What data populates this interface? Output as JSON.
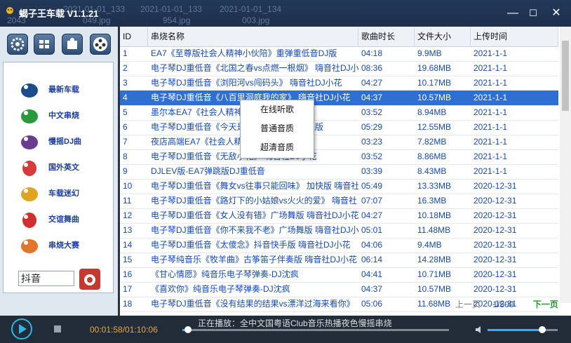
{
  "window": {
    "title": "蝎子王车载 V1.1.21",
    "ghost_files": [
      "2021-01-01_133",
      "2021-01-01_133",
      "2021-01-01_134"
    ],
    "ghost_sub": [
      "2043",
      "049.jpg",
      "954.jpg",
      "003.jpg"
    ],
    "minimize": "—",
    "maximize": "☐",
    "close": "✕"
  },
  "toolbar": [
    "gear-icon",
    "window-icon",
    "puzzle-icon",
    "film-reel-icon"
  ],
  "categories": [
    {
      "label": "最新车载",
      "color": "#1d4c8c"
    },
    {
      "label": "中文串烧",
      "color": "#2c9a3c"
    },
    {
      "label": "慢摇DJ曲",
      "color": "#6a3c8f"
    },
    {
      "label": "国外英文",
      "color": "#d63a3a"
    },
    {
      "label": "车载迷幻",
      "color": "#e0a420"
    },
    {
      "label": "交谊舞曲",
      "color": "#d12f2f"
    },
    {
      "label": "串烧大赛",
      "color": "#e0762a"
    }
  ],
  "search": {
    "value": "抖音"
  },
  "table": {
    "headers": [
      "ID",
      "串烧名称",
      "歌曲时长",
      "文件大小",
      "上传时间"
    ],
    "rows": [
      [
        "1",
        "EA7《至尊版社会人精神小伙陪》重弹重低音DJ版",
        "04:18",
        "9.9MB",
        "2021-1-1"
      ],
      [
        "2",
        "电子琴DJ重低音《北国之春vs点燃一根烟》 嗨音社DJ小花",
        "08:36",
        "19.68MB",
        "2021-1-1"
      ],
      [
        "3",
        "电子琴DJ重低音《浏阳河vs闯码头》 嗨音社DJ小花",
        "04:27",
        "10.17MB",
        "2021-1-1"
      ],
      [
        "4",
        "电子琴DJ重低音《八百里洞庭我的家》 嗨音社DJ小花",
        "04:37",
        "10.57MB",
        "2021-1-1"
      ],
      [
        "5",
        "墨尔本EA7《社会人精神小伙》",
        "03:52",
        "8.94MB",
        "2021-1-1"
      ],
      [
        "6",
        "电子琴DJ重低音《今天是你的生日》 广场舞版",
        "05:29",
        "12.55MB",
        "2021-1-1"
      ],
      [
        "7",
        "夜店高端EA7《社会人精神小伙》重弹DJ版",
        "03:23",
        "7.82MB",
        "2021-1-1"
      ],
      [
        "8",
        "电子琴DJ重低音《无敌小花》 嗨音社DJ小花",
        "03:52",
        "8.86MB",
        "2021-1-1"
      ],
      [
        "9",
        "DJLEV版-EA7弹跳版DJ重低音",
        "03:39",
        "8.43MB",
        "2021-1-1"
      ],
      [
        "10",
        "电子琴DJ重低音《舞女vs往事只能回味》 加快版 嗨音社",
        "05:49",
        "13.33MB",
        "2020-12-31"
      ],
      [
        "11",
        "电子琴DJ重低音《路灯下的小姑娘vs火火的爱》 嗨音社",
        "07:07",
        "16.3MB",
        "2020-12-31"
      ],
      [
        "12",
        "电子琴DJ重低音《女人没有错》广场舞版 嗨音社DJ小花",
        "04:27",
        "10.18MB",
        "2020-12-31"
      ],
      [
        "13",
        "电子琴DJ重低音《你不来我不老》广场舞版 嗨音社DJ小花",
        "05:01",
        "11.48MB",
        "2020-12-31"
      ],
      [
        "14",
        "电子琴DJ重低音《太傻念》抖音快手版 嗨音社DJ小花",
        "04:06",
        "9.4MB",
        "2020-12-31"
      ],
      [
        "15",
        "电子琴纯音乐《牧羊曲》古筝笛子伴奏版 嗨音社DJ小花",
        "06:14",
        "14.28MB",
        "2020-12-31"
      ],
      [
        "16",
        "《甘心情愿》纯音乐电子琴弹奏-DJ沈疯",
        "04:41",
        "10.71MB",
        "2020-12-31"
      ],
      [
        "17",
        "《喜欢你》纯音乐电子琴弹奏-DJ沈疯",
        "04:37",
        "10.57MB",
        "2020-12-31"
      ],
      [
        "18",
        "电子琴DJ重低音《没有结果的结果vs漂洋过海来看你》",
        "05:06",
        "11.68MB",
        "2020-12-31"
      ]
    ],
    "selected_index": 3
  },
  "pager": {
    "prev": "上一页",
    "page": "1/500",
    "next": "下一页"
  },
  "context_menu": [
    "在线听歌",
    "普通音质",
    "超清音质"
  ],
  "player": {
    "time": "00:01:58/01:10:06",
    "now_playing": "正在播放：全中文国粤语Club音乐热播夜色慢摇串烧",
    "progress": 0.02,
    "volume": 0.78
  },
  "colors": {
    "selected_row": "#2f6fd0",
    "link_text": "#1749b8",
    "accent": "#2ab6e8",
    "time": "#e8a540"
  }
}
